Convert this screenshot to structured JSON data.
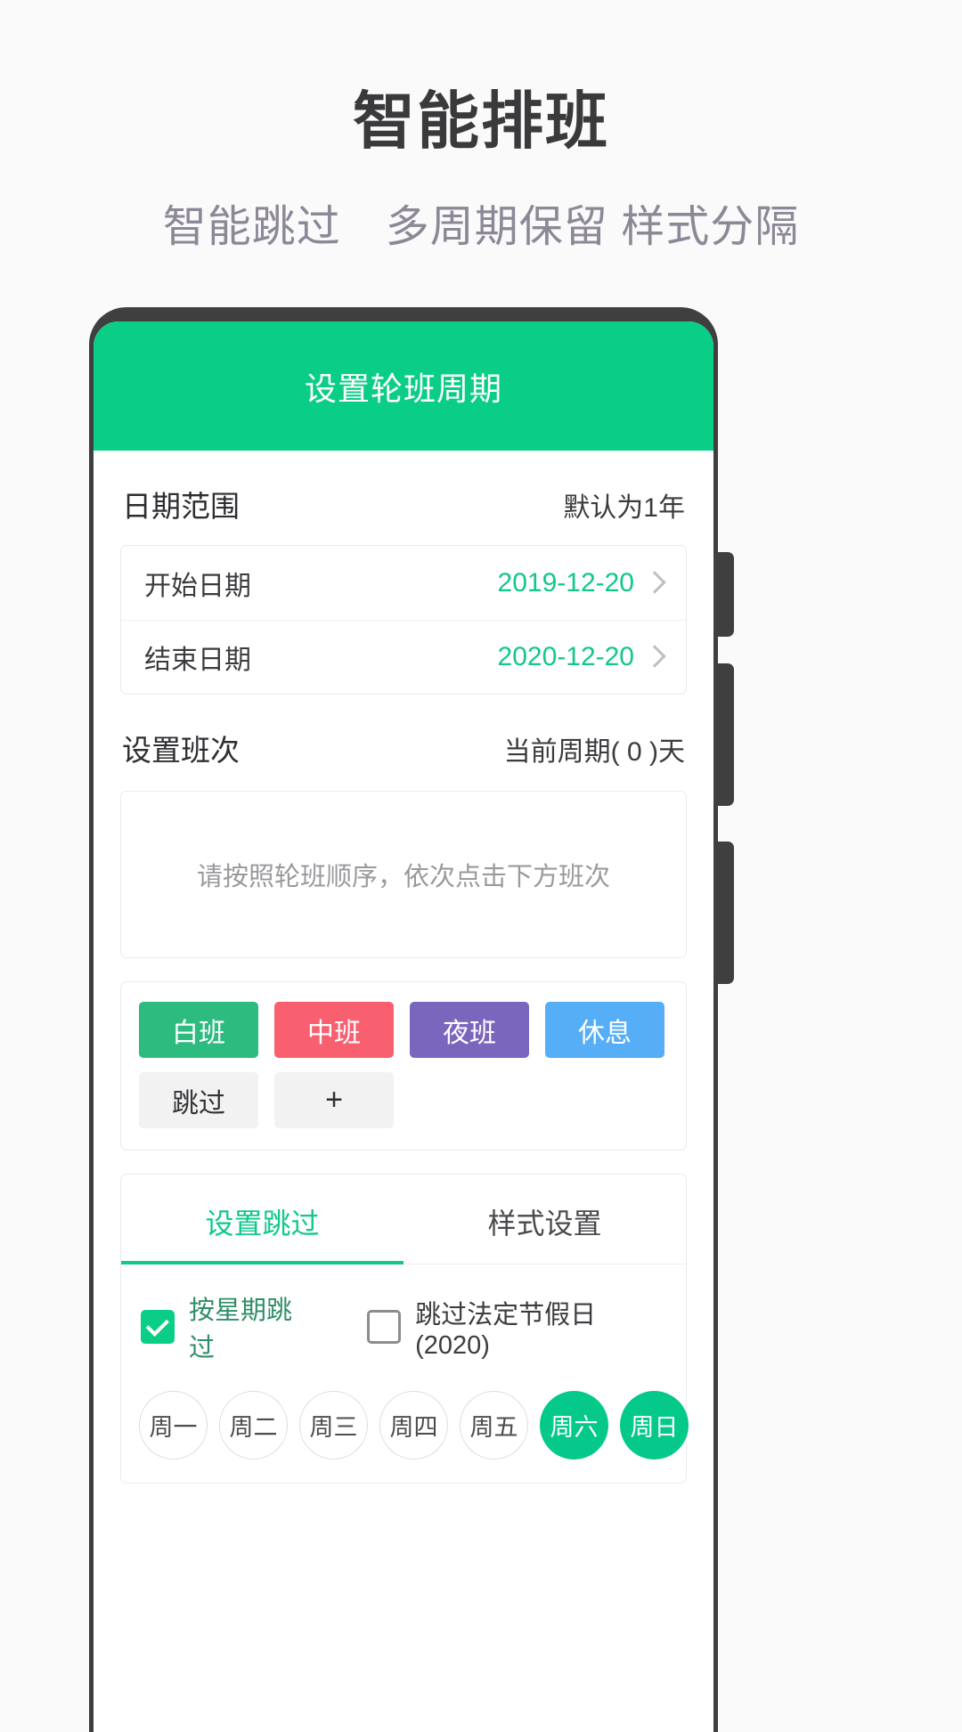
{
  "promo": {
    "title": "智能排班",
    "subtitle": "智能跳过　多周期保留 样式分隔"
  },
  "app": {
    "appbar_title": "设置轮班周期",
    "theme_color": "#0BCE86",
    "date_range": {
      "title": "日期范围",
      "note": "默认为1年",
      "rows": [
        {
          "label": "开始日期",
          "value": "2019-12-20"
        },
        {
          "label": "结束日期",
          "value": "2020-12-20"
        }
      ]
    },
    "shift_setup": {
      "title": "设置班次",
      "note": "当前周期( 0 )天",
      "sequence_hint": "请按照轮班顺序，依次点击下方班次"
    },
    "palette": {
      "row1": [
        {
          "label": "白班",
          "color": "#2EBB80"
        },
        {
          "label": "中班",
          "color": "#F9606F"
        },
        {
          "label": "夜班",
          "color": "#7B66BE"
        },
        {
          "label": "休息",
          "color": "#56AEF7"
        }
      ],
      "row2": [
        {
          "label": "跳过"
        },
        {
          "label": "+"
        }
      ]
    },
    "tabs": [
      {
        "label": "设置跳过",
        "active": true
      },
      {
        "label": "样式设置",
        "active": false
      }
    ],
    "skip_options": [
      {
        "label": "按星期跳过",
        "checked": true
      },
      {
        "label": "跳过法定节假日(2020)",
        "checked": false
      }
    ],
    "weekdays": [
      {
        "label": "周一",
        "selected": false
      },
      {
        "label": "周二",
        "selected": false
      },
      {
        "label": "周三",
        "selected": false
      },
      {
        "label": "周四",
        "selected": false
      },
      {
        "label": "周五",
        "selected": false
      },
      {
        "label": "周六",
        "selected": true
      },
      {
        "label": "周日",
        "selected": true
      }
    ]
  }
}
